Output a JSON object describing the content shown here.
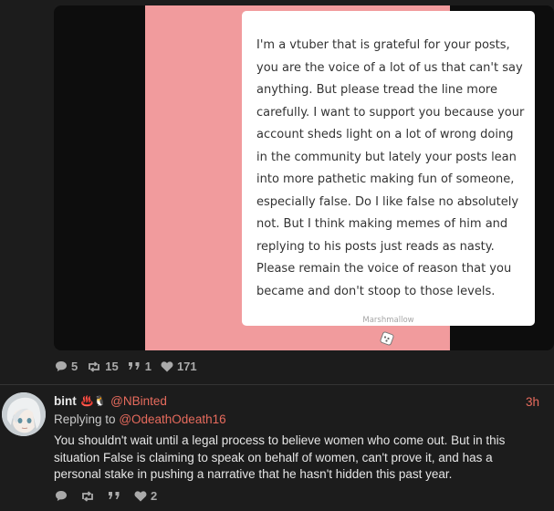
{
  "media": {
    "text": "I'm a vtuber that is grateful for your posts, you are the voice of a lot of us that can't say anything. But please tread the line more carefully. I want to support you because your account sheds light on a lot of wrong doing in the community but lately your posts lean into more pathetic making fun of someone, especially false. Do I like false no absolutely not. But I think making memes of him and replying to his posts just reads as nasty. Please remain the voice of reason that you became and don't stoop to those levels.",
    "brand": "Marshmallow"
  },
  "post_stats": {
    "replies": "5",
    "reposts": "15",
    "quotes": "1",
    "likes": "171"
  },
  "reply": {
    "name": "bint",
    "emoji": "♨️🐧",
    "handle": "@NBinted",
    "time": "3h",
    "replying_prefix": "Replying to",
    "replying_to": "@OdeathOdeath16",
    "text": "You shouldn't wait until a legal process to believe women who come out. But in this situation False is claiming to speak on behalf of women, can't prove it, and has a personal stake in pushing a narrative that he hasn't hidden this past year.",
    "likes": "2"
  },
  "colors": {
    "accent": "#e76b5d",
    "marshmallow_pink": "#f19b9d",
    "background": "#1c1c1c"
  }
}
